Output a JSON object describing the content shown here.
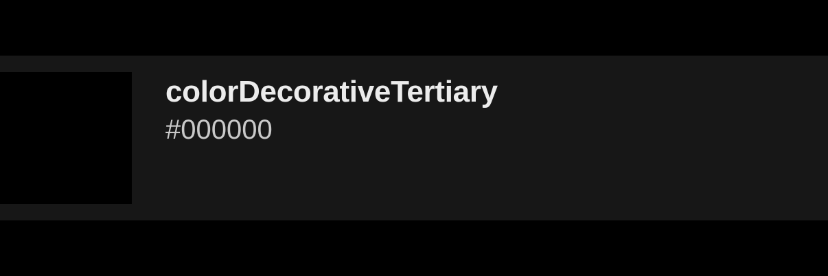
{
  "token": {
    "name": "colorDecorativeTertiary",
    "hex": "#000000",
    "swatch_color": "#000000"
  },
  "colors": {
    "background": "#000000",
    "row_background": "#171717",
    "name_text": "#ececec",
    "hex_text": "#c9c9c9"
  }
}
